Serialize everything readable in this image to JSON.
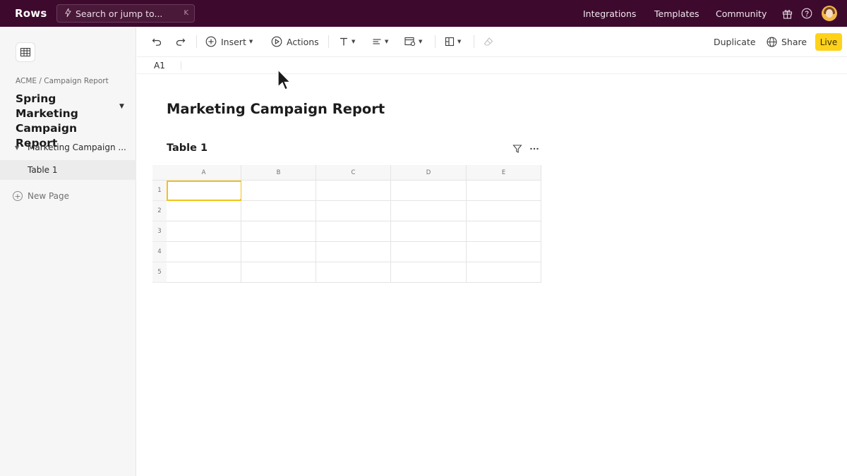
{
  "app": {
    "logo": "Rows",
    "search_placeholder": "Search or jump to...",
    "search_shortcut": "K",
    "nav": [
      "Integrations",
      "Templates",
      "Community"
    ]
  },
  "sidebar": {
    "breadcrumb": "ACME / Campaign Report",
    "doc_title": "Spring Marketing Campaign Report",
    "pages": [
      {
        "label": "Marketing Campaign ...",
        "expanded": true
      },
      {
        "label": "Table 1",
        "active": true
      }
    ],
    "new_page_label": "New Page"
  },
  "toolbar": {
    "insert_label": "Insert",
    "actions_label": "Actions",
    "duplicate_label": "Duplicate",
    "share_label": "Share",
    "live_label": "Live"
  },
  "formula_bar": {
    "cell_ref": "A1"
  },
  "page": {
    "title": "Marketing Campaign Report",
    "table_title": "Table 1"
  },
  "grid": {
    "columns": [
      "A",
      "B",
      "C",
      "D",
      "E"
    ],
    "rows": [
      "1",
      "2",
      "3",
      "4",
      "5"
    ],
    "selected_cell": "A1"
  },
  "colors": {
    "topbar": "#3d0a2e",
    "accent_yellow": "#ffd21a",
    "selection": "#f2c318"
  }
}
